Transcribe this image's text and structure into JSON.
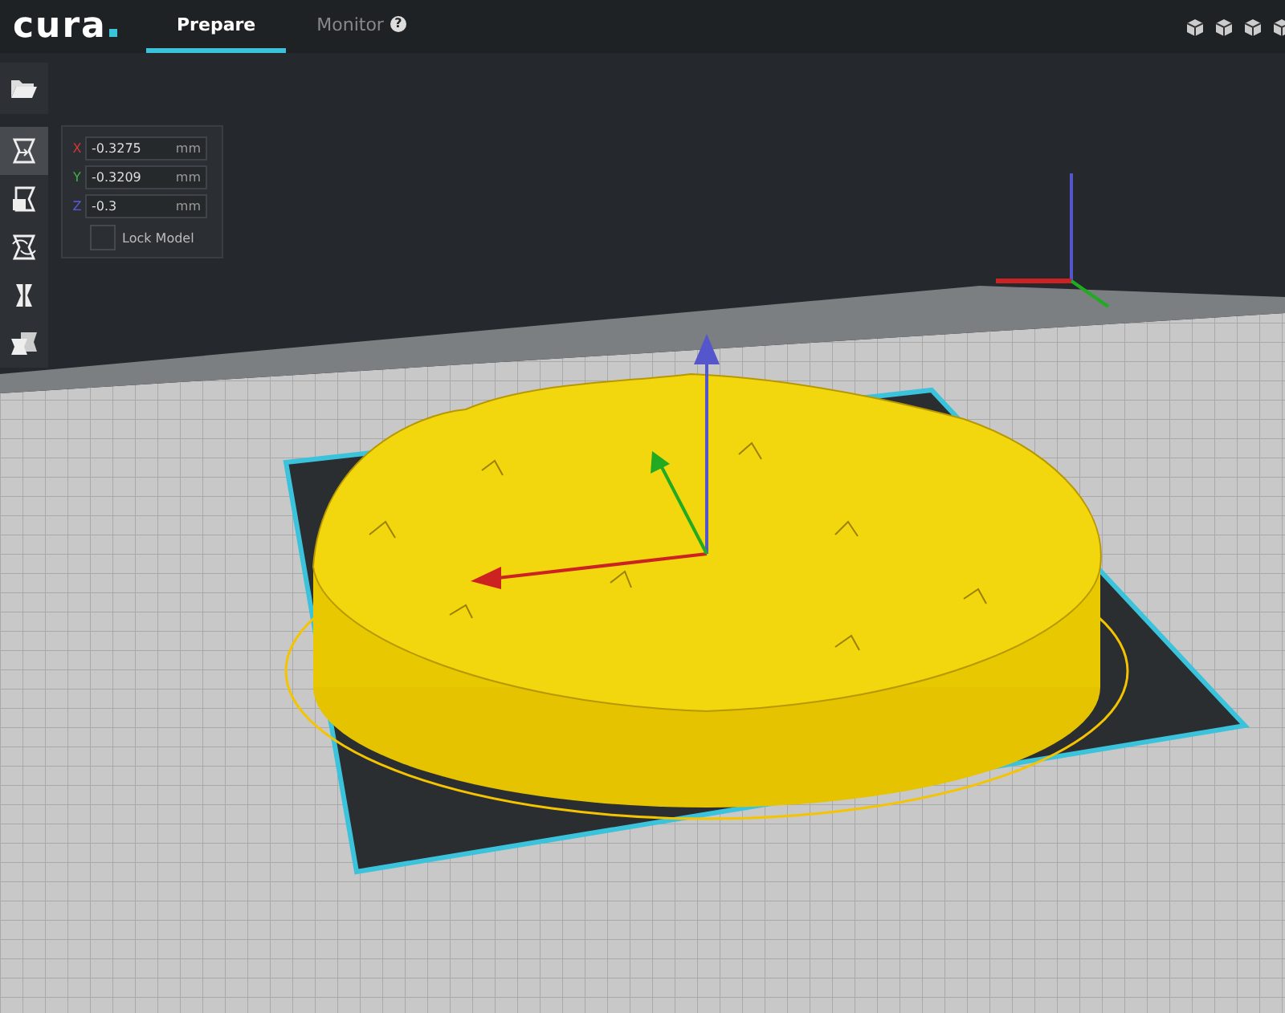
{
  "header": {
    "logo": "cura",
    "tabs": [
      {
        "label": "Prepare",
        "selected": true
      },
      {
        "label": "Monitor",
        "selected": false,
        "badge": "?"
      }
    ]
  },
  "toolbar": {
    "tools": [
      {
        "kind": "move",
        "selected": true
      },
      {
        "kind": "scale",
        "selected": false
      },
      {
        "kind": "rotate",
        "selected": false
      },
      {
        "kind": "mirror",
        "selected": false
      },
      {
        "kind": "per-model",
        "selected": false
      }
    ]
  },
  "move_panel": {
    "fields": [
      {
        "axis": "X",
        "color": "#d0383a",
        "value": "-0.3275",
        "unit": "mm"
      },
      {
        "axis": "Y",
        "color": "#3fb53f",
        "value": "-0.3209",
        "unit": "mm"
      },
      {
        "axis": "Z",
        "color": "#5b5bd6",
        "value": "-0.3",
        "unit": "mm"
      }
    ],
    "lock_model": {
      "label": "Lock Model",
      "checked": false
    }
  }
}
